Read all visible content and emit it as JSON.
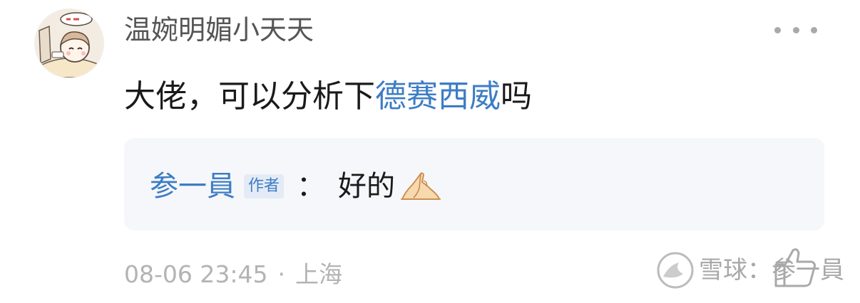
{
  "comment": {
    "username": "温婉明媚小天天",
    "avatar_icon": "cartoon-avatar",
    "text_prefix": "大佬，可以分析下",
    "stock_link": "德赛西威",
    "text_suffix": "吗"
  },
  "reply": {
    "author": "参一員",
    "badge": "作者",
    "colon": "：",
    "text": "好的",
    "emoji": "praying-hands-icon"
  },
  "meta": {
    "time": "08-06 23:45",
    "separator": "·",
    "location": "上海"
  },
  "watermark": {
    "text": "雪球：参一員"
  },
  "actions": {
    "more_icon": "more-dots-icon",
    "like_icon": "thumbs-up-icon"
  },
  "colors": {
    "link": "#3d7dc4",
    "reply_bg": "#f6f7fa",
    "meta": "#b3b3b3"
  }
}
